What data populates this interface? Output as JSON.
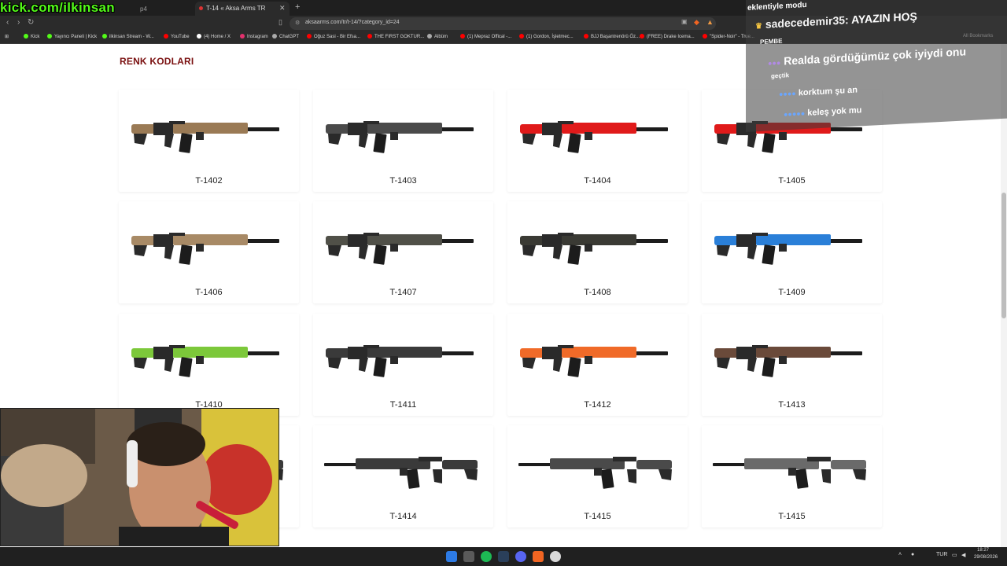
{
  "browser": {
    "tab_title": "T-14 « Aksa Arms TR",
    "ghost_tab": "p4",
    "url": "aksaarms.com/tr/t-14/?category_id=24",
    "bookmarks": [
      {
        "label": "Kick",
        "color": "#53fc18"
      },
      {
        "label": "Yayıncı Paneli | Kick",
        "color": "#53fc18"
      },
      {
        "label": "ilkinsan Stream - W...",
        "color": "#53fc18"
      },
      {
        "label": "YouTube",
        "color": "#ff0000"
      },
      {
        "label": "(4) Home / X",
        "color": "#ffffff"
      },
      {
        "label": "Instagram",
        "color": "#e1306c"
      },
      {
        "label": "ChatGPT",
        "color": "#aaaaaa"
      },
      {
        "label": "Oğuz Sasi - Bir Efsa...",
        "color": "#ff0000"
      },
      {
        "label": "THE FIRST GOKTUR...",
        "color": "#ff0000"
      },
      {
        "label": "Albüm",
        "color": "#aaaaaa"
      },
      {
        "label": "(1) Mepraz Offical -...",
        "color": "#ff0000"
      },
      {
        "label": "(1) Gordon, İşletmec...",
        "color": "#ff0000"
      },
      {
        "label": "BJJ Başantrenörü Öz...",
        "color": "#ff0000"
      },
      {
        "label": "(FREE) Drake Icema...",
        "color": "#ff0000"
      },
      {
        "label": "\"Spider-Noir\" - True...",
        "color": "#ff0000"
      }
    ],
    "all_bookmarks": "All Bookmarks"
  },
  "overlay": {
    "kick_watermark": "kick.com/ilkinsan",
    "chat": [
      {
        "user": "",
        "msg": "eklentiyle modu"
      },
      {
        "user": "sadecedemir35:",
        "msg": "AYAZIN HOŞ"
      },
      {
        "user": "",
        "msg": "PEMBE"
      },
      {
        "user": "",
        "msg": "Realda gördüğümüz çok iyiydi onu"
      },
      {
        "user": "",
        "msg": "geçtik"
      },
      {
        "user": "",
        "msg": "korktum şu an"
      },
      {
        "user": "",
        "msg": "keleş yok mu"
      }
    ]
  },
  "page": {
    "section_title": "RENK KODLARI",
    "products": [
      {
        "code": "T-1402",
        "accent": "#9a7a55",
        "body": "#2a2a2a",
        "side": "right"
      },
      {
        "code": "T-1403",
        "accent": "#4a4a4a",
        "body": "#2a2a2a",
        "side": "right"
      },
      {
        "code": "T-1404",
        "accent": "#e01a1a",
        "body": "#2a2a2a",
        "side": "right"
      },
      {
        "code": "T-1405",
        "accent": "#e01a1a",
        "body": "#2a2a2a",
        "side": "right"
      },
      {
        "code": "T-1406",
        "accent": "#a88a66",
        "body": "#2a2a2a",
        "side": "right"
      },
      {
        "code": "T-1407",
        "accent": "#505048",
        "body": "#2a2a2a",
        "side": "right"
      },
      {
        "code": "T-1408",
        "accent": "#3a3a34",
        "body": "#2a2a2a",
        "side": "right"
      },
      {
        "code": "T-1409",
        "accent": "#2a7fd8",
        "body": "#2a2a2a",
        "side": "right"
      },
      {
        "code": "T-1410",
        "accent": "#7cc83a",
        "body": "#2a2a2a",
        "side": "right"
      },
      {
        "code": "T-1411",
        "accent": "#3a3a3a",
        "body": "#2a2a2a",
        "side": "right"
      },
      {
        "code": "T-1412",
        "accent": "#f06a28",
        "body": "#2a2a2a",
        "side": "right"
      },
      {
        "code": "T-1413",
        "accent": "#6a4a3a",
        "body": "#2a2a2a",
        "side": "right"
      },
      {
        "code": "",
        "accent": "#3a3a3a",
        "body": "#2a2a2a",
        "side": "left"
      },
      {
        "code": "T-1414",
        "accent": "#3a3a3a",
        "body": "#2a2a2a",
        "side": "left"
      },
      {
        "code": "T-1415",
        "accent": "#4a4a4a",
        "body": "#2a2a2a",
        "side": "left"
      },
      {
        "code": "T-1415",
        "accent": "#6a6a6a",
        "body": "#2a2a2a",
        "side": "left"
      }
    ]
  },
  "taskbar": {
    "lang": "TUR",
    "time": "18:27",
    "date": "29/08/2026"
  }
}
